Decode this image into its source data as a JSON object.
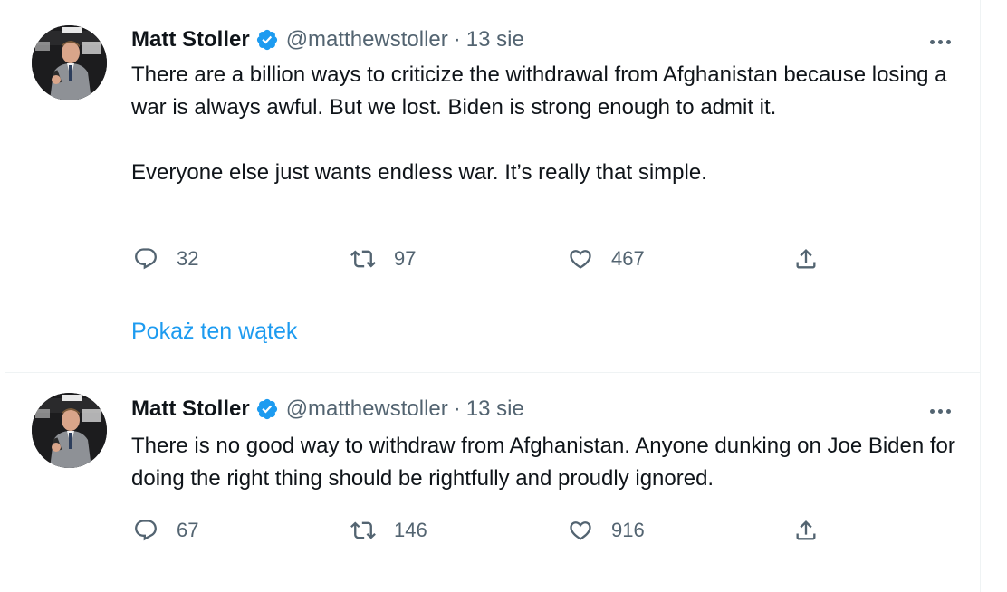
{
  "tweets": [
    {
      "author": {
        "name": "Matt Stoller",
        "handle": "@matthewstoller",
        "verified": true
      },
      "separator": "·",
      "time": "13 sie",
      "text": [
        "There are a billion ways to criticize the withdrawal from Afghanistan because losing a war is always awful. But we lost. Biden is strong enough to admit it.",
        "Everyone else just wants endless war. It’s really that simple."
      ],
      "replies": "32",
      "retweets": "97",
      "likes": "467",
      "show_thread": "Pokaż ten wątek"
    },
    {
      "author": {
        "name": "Matt Stoller",
        "handle": "@matthewstoller",
        "verified": true
      },
      "separator": "·",
      "time": "13 sie",
      "text": [
        "There is no good way to withdraw from Afghanistan. Anyone dunking on Joe Biden for doing the right thing should be rightfully and proudly ignored."
      ],
      "replies": "67",
      "retweets": "146",
      "likes": "916"
    }
  ],
  "colors": {
    "accent": "#1d9bf0",
    "text_primary": "#0f1419",
    "text_secondary": "#536471",
    "border": "#eff3f4"
  },
  "icons": [
    "verified-badge-icon",
    "more-icon",
    "reply-icon",
    "retweet-icon",
    "like-icon",
    "share-icon"
  ]
}
